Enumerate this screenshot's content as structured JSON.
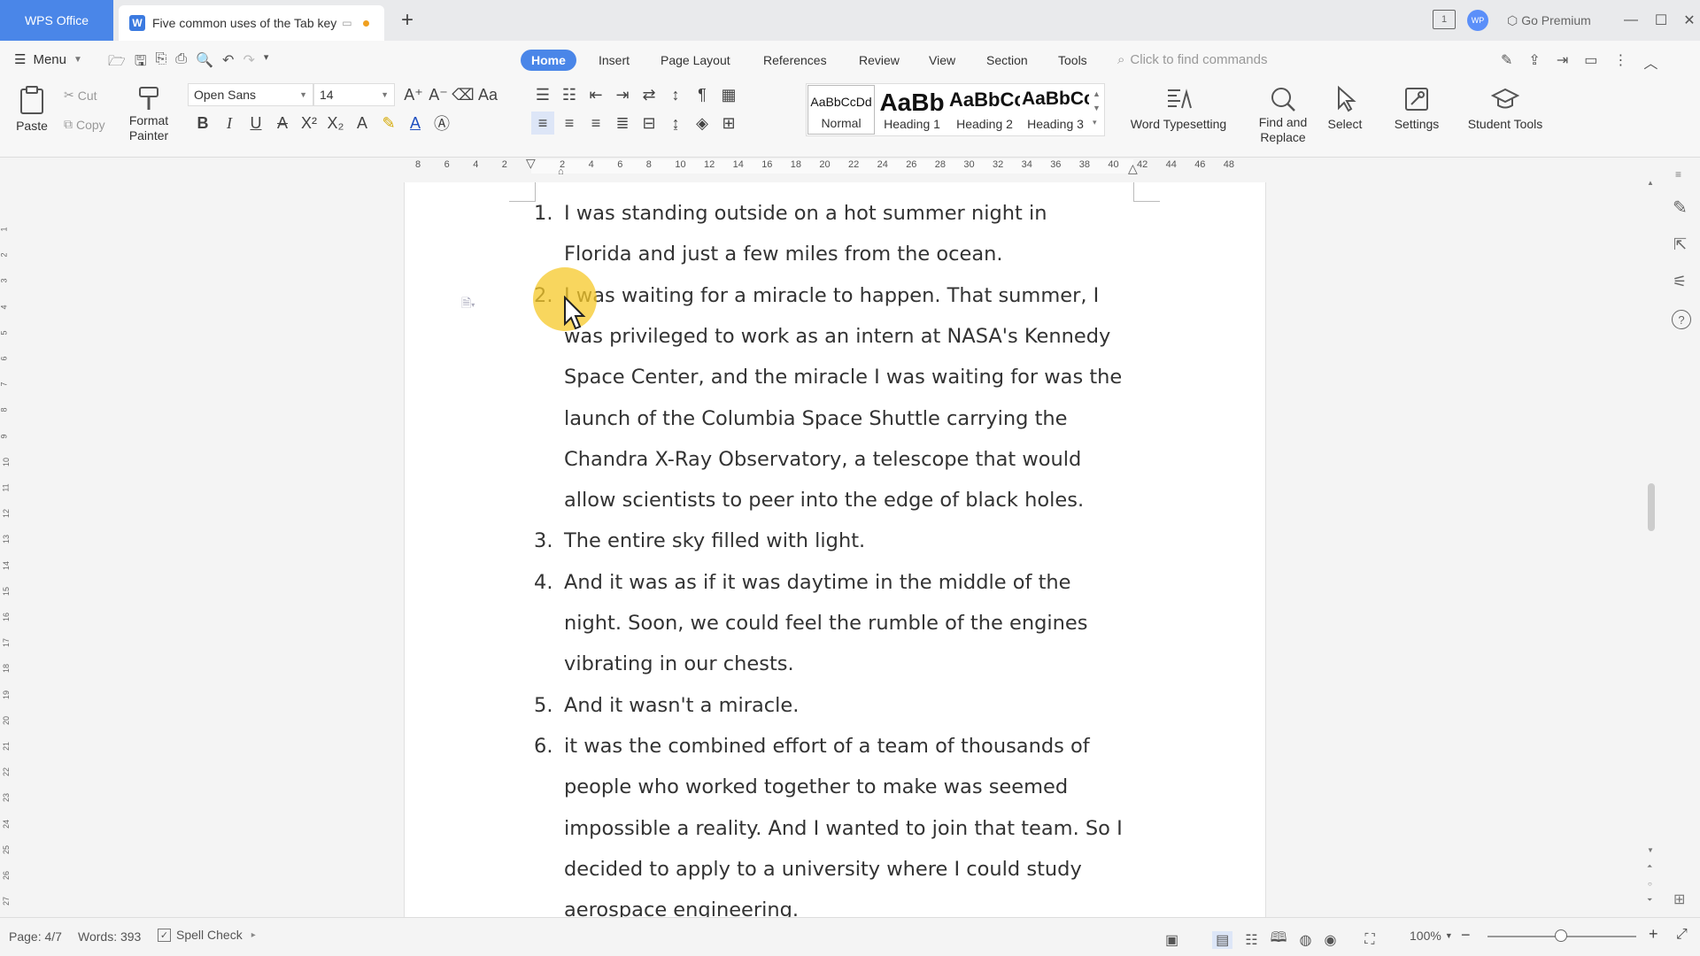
{
  "titlebar": {
    "app_button": "WPS Office",
    "doc_tab_title": "Five common uses of the Tab key",
    "doc_tab_icon": "W",
    "new_tab": "+",
    "avatar": "WP",
    "go_premium": "Go Premium"
  },
  "menu": {
    "menu_label": "Menu",
    "tabs": [
      "Home",
      "Insert",
      "Page Layout",
      "References",
      "Review",
      "View",
      "Section",
      "Tools"
    ],
    "active_tab": "Home",
    "search_placeholder": "Click to find commands"
  },
  "ribbon": {
    "paste": "Paste",
    "cut": "Cut",
    "copy": "Copy",
    "format_painter_line1": "Format",
    "format_painter_line2": "Painter",
    "font_name": "Open Sans",
    "font_size": "14",
    "styles": [
      {
        "preview": "AaBbCcDd",
        "label": "Normal"
      },
      {
        "preview": "AaBb",
        "label": "Heading 1"
      },
      {
        "preview": "AaBbCc",
        "label": "Heading 2"
      },
      {
        "preview": "AaBbCc",
        "label": "Heading 3"
      }
    ],
    "word_typesetting": "Word Typesetting",
    "find_replace_line1": "Find and",
    "find_replace_line2": "Replace",
    "select": "Select",
    "settings": "Settings",
    "student_tools": "Student Tools"
  },
  "ruler": {
    "numbers": [
      "8",
      "6",
      "4",
      "2",
      "",
      "2",
      "4",
      "6",
      "8",
      "10",
      "12",
      "14",
      "16",
      "18",
      "20",
      "22",
      "24",
      "26",
      "28",
      "30",
      "32",
      "34",
      "36",
      "38",
      "40",
      "42",
      "44",
      "46",
      "48"
    ],
    "vertical_numbers": [
      "1",
      "2",
      "3",
      "4",
      "5",
      "6",
      "7",
      "8",
      "9",
      "10",
      "11",
      "12",
      "13",
      "14",
      "15",
      "16",
      "17",
      "18",
      "19",
      "20",
      "21",
      "22",
      "23",
      "24",
      "25",
      "26",
      "27"
    ]
  },
  "document": {
    "lines": [
      {
        "num": "1.",
        "text": "I was standing outside on a hot summer night in"
      },
      {
        "num": "",
        "text": "Florida and just a few miles from the ocean."
      },
      {
        "num": "2.",
        "text": "I was waiting for a miracle to happen. That summer, I"
      },
      {
        "num": "",
        "text": "was privileged to work as an intern at NASA's Kennedy"
      },
      {
        "num": "",
        "text": "Space Center, and the miracle I was waiting for was the"
      },
      {
        "num": "",
        "text": "launch of the Columbia Space Shuttle carrying the"
      },
      {
        "num": "",
        "text": "Chandra X-Ray Observatory, a telescope that would"
      },
      {
        "num": "",
        "text": "allow scientists to peer into the edge of black holes."
      },
      {
        "num": "3.",
        "text": "The entire sky filled with light."
      },
      {
        "num": "4.",
        "text": "And it was as if it was daytime in the middle of the"
      },
      {
        "num": "",
        "text": "night. Soon, we could feel the rumble of the engines"
      },
      {
        "num": "",
        "text": "vibrating in our chests."
      },
      {
        "num": "5.",
        "text": " And it wasn't a miracle."
      },
      {
        "num": "6.",
        "text": "it was the combined effort of a team of thousands of"
      },
      {
        "num": "",
        "text": "people who worked together to make was seemed"
      },
      {
        "num": "",
        "text": "impossible a reality. And I wanted to join that team. So I"
      },
      {
        "num": "",
        "text": "decided to apply to a university where I could study"
      },
      {
        "num": "",
        "text": "aerospace engineering."
      }
    ]
  },
  "status": {
    "page": "Page: 4/7",
    "words": "Words: 393",
    "spell_check": "Spell Check",
    "zoom": "100%"
  },
  "colors": {
    "accent": "#4a86e8",
    "cursor_highlight": "#f5c828"
  }
}
